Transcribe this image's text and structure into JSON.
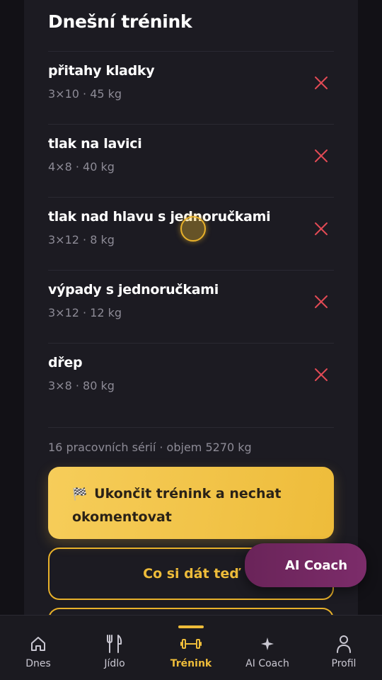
{
  "page": {
    "title": "Dnešní trénink"
  },
  "exercises": [
    {
      "name": "přitahy kladky",
      "meta": "3×10 · 45 kg"
    },
    {
      "name": "tlak na lavici",
      "meta": "4×8 · 40 kg"
    },
    {
      "name": "tlak nad hlavu s jednoručkami",
      "meta": "3×12 · 8 kg"
    },
    {
      "name": "výpady s jednoručkami",
      "meta": "3×12 · 12 kg"
    },
    {
      "name": "dřep",
      "meta": "3×8 · 80 kg"
    }
  ],
  "summary": "16 pracovních sérií · objem 5270 kg",
  "actions": {
    "finish_label": "Ukončit trénink a nechat okomentovat",
    "finish_icon": "checkered-flag-icon",
    "suggest_label": "Co si dát teď"
  },
  "ai_fab": {
    "label": "AI Coach"
  },
  "nav": {
    "items": [
      {
        "label": "Dnes",
        "icon": "home-icon"
      },
      {
        "label": "Jídlo",
        "icon": "fork-knife-icon"
      },
      {
        "label": "Trénink",
        "icon": "dumbbell-icon"
      },
      {
        "label": "AI Coach",
        "icon": "sparkle-icon"
      },
      {
        "label": "Profil",
        "icon": "person-icon"
      }
    ],
    "active": "Trénink"
  },
  "colors": {
    "background": "#121116",
    "card": "#1c1b22",
    "accent": "#eebc3a",
    "remove": "#e24a55",
    "ai_fab": "#7c2c6a",
    "muted_text": "#8d8b96"
  }
}
